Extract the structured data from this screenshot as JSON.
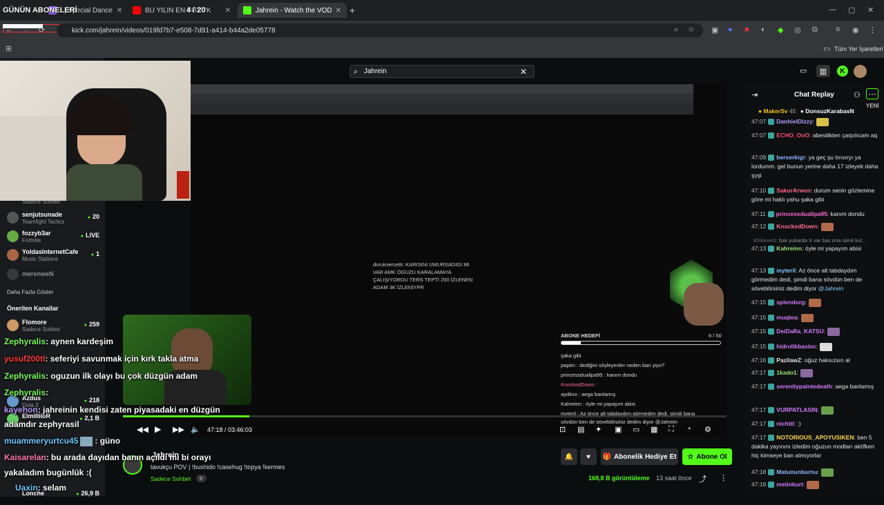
{
  "overlay_title": "GÜNÜN ABONELERİ",
  "tabs": [
    {
      "label": "l | Special Dance",
      "counter": "",
      "fav": "#8b5cf6"
    },
    {
      "label": "BU YILIN EN BÜYÜK SKANDALI",
      "counter": "4 / 20",
      "fav": "#ff0000"
    },
    {
      "label": "Jahrein - Watch the VOD on Kick",
      "counter": "",
      "fav": "#53fc18"
    }
  ],
  "new_tab": "+",
  "url": "kick.com/jahrein/videos/019fd7b7-e508-7d91-a414-b44a2de05778",
  "bookmarks_label": "Tüm Yer İşaretleri",
  "search_value": "Jahrein",
  "sidebar": {
    "channels": [
      {
        "name": "",
        "category": "Sadece Sohbet",
        "viewers": ""
      },
      {
        "name": "senjutsunade",
        "category": "Teamfight Tactics",
        "viewers": "20"
      },
      {
        "name": "fozzyb3ar",
        "category": "Fortnite",
        "viewers": "LIVE"
      },
      {
        "name": "YoldasInternetCafe",
        "category": "Music Stations",
        "viewers": "1"
      },
      {
        "name": "merenweN",
        "category": "",
        "viewers": ""
      }
    ],
    "show_more": "Daha Fazla Göster",
    "recommended_title": "Önerilen Kanallar",
    "recommended": [
      {
        "name": "Flomore",
        "category": "Sadece Sohbet",
        "viewers": "259"
      },
      {
        "name": "Azdus",
        "category": "Dota 2",
        "viewers": "218"
      },
      {
        "name": "ElmilliioR",
        "category": "",
        "viewers": "2,1 B"
      },
      {
        "name": "Lonche",
        "category": "",
        "viewers": "26,9 B"
      }
    ]
  },
  "overlay_chat": [
    {
      "user": "Zephyralis",
      "color": "#7cfc5a",
      "msg": ": aynen kardeşim"
    },
    {
      "user": "yusuf200tl",
      "color": "#ff3b3b",
      "msg": ": seferiyi savunmak için kırk takla atma"
    },
    {
      "user": "Zephyralis",
      "color": "#7cfc5a",
      "msg": ": oguzun ilk olayı bu çok düzgün adam"
    },
    {
      "user": "Zephyralis",
      "color": "#7cfc5a",
      "msg": ":"
    },
    {
      "user": "kayehon",
      "color": "#b59cff",
      "msg": ": jahreinin kendisi zaten piyasadaki en düzgün"
    },
    {
      "user": "",
      "color": "#fff",
      "msg": "adamdır zephyrasil"
    },
    {
      "user": "muammeryurtcu45",
      "color": "#6ec6ff",
      "msg": ": güno"
    },
    {
      "user": "Kaisarelan",
      "color": "#ff7ab0",
      "msg": ": bu arada dayıdan banın açıldı mı bi orayı"
    },
    {
      "user": "",
      "color": "#fff",
      "msg": "yakaladım bugünlük :("
    },
    {
      "user": "Uaxin",
      "color": "#6ec6ff",
      "msg": ": selam"
    }
  ],
  "game_stream_chat": {
    "highlight": "dorukvercetti: KARISINI UMURSADIGI MI VAR AMK OGUZU KARALAMAYA ÇALIŞIYORDU TERS TEPTİ 200 İZLENEN ADAM 3K İZLENİYPR",
    "sub_goal": "ABONE HEDEFİ",
    "sub_count": "6 / 50",
    "lines": [
      "şaka gibi",
      "papen : dediğini söyleyenler neden ban yiyo?",
      "princessdualipa95 : kanım dondu",
      "KnockedDown :",
      "aydiino : aega banlamış",
      "Kahreinn : öyle mi yapayım abisi",
      "myteril : Az önce alt tabdaydım görmedim dedi, şimdi bana",
      "sövdün ben de sövebilirsiniz dedim diyor @Jahrein"
    ]
  },
  "player": {
    "time": "47:18 / 03:46:03",
    "progress": 0.209
  },
  "video": {
    "channel": "Jahrein",
    "title": "tavukçu POV | !bushido !casehug !topya !kermes",
    "category": "Sadece Sohbet",
    "lang": "tr",
    "views": "168,8 B görüntüleme",
    "ago": "13 saat önce",
    "gift_label": "Abonelik Hediye Et",
    "sub_label": "Abone Ol"
  },
  "chat": {
    "title": "Chat Replay",
    "new_badge": "YENİ",
    "pinned": [
      {
        "user": "MakerSv",
        "count": "45"
      },
      {
        "user": "DonsuzKarabasN",
        "count": ""
      }
    ],
    "messages": [
      {
        "t": "47:07",
        "u": "DanhielDizzy",
        "c": "#b59cff",
        "m": ":",
        "e": "#d6c24a"
      },
      {
        "t": "47:07",
        "u": "ECHO_OoO",
        "c": "#ff4d6d",
        "m": ": abesilikten çarpılıcam aq",
        "e": ""
      },
      {
        "t": "47:09",
        "u": "berserkigr",
        "c": "#8fb8ff",
        "m": ": ya geç şu tırıvıryı ya lordumm. gel bunun yerine daha 17 izleyek daha şyşi",
        "e": ""
      },
      {
        "t": "47:10",
        "u": "SakurArwen",
        "c": "#ff6b8a",
        "m": ": durum senin gözlemine göre mi haklı yahu şaka gibi",
        "e": ""
      },
      {
        "t": "47:11",
        "u": "princessdualipa95",
        "c": "#ff6bd0",
        "m": ": kanım dondu",
        "e": ""
      },
      {
        "t": "47:12",
        "u": "KnockedDown",
        "c": "#ff6b8a",
        "m": ":",
        "e": "#b06a4a"
      },
      {
        "t": "",
        "u": "KhloreeX",
        "c": "#888",
        "m": ": bak yukarda X var bas ona isimli kul...",
        "e": ""
      },
      {
        "t": "47:13",
        "u": "Kahreinn",
        "c": "#9be47a",
        "m": ": öyle mi yapayım abisi",
        "e": ""
      },
      {
        "t": "47:13",
        "u": "myteril",
        "c": "#7ec8ff",
        "m": ": Az önce alt tabdaydım görmedim dedi, şimdi bana sövdün ben de sövebilirsiniz dedim diyor",
        "mention": "@Jahrein",
        "e": ""
      },
      {
        "t": "47:15",
        "u": "splendorg",
        "c": "#d47cff",
        "m": ":",
        "e": "#b06a4a"
      },
      {
        "t": "47:15",
        "u": "muqtea",
        "c": "#d47cff",
        "m": ":",
        "e": "#b06a4a"
      },
      {
        "t": "47:15",
        "u": "DeiDaRa_KATSU",
        "c": "#d47cff",
        "m": ":",
        "e": "#8a6aa0"
      },
      {
        "t": "47:15",
        "u": "hidrolikbasinc",
        "c": "#d47cff",
        "m": ":",
        "e": "#ddd"
      },
      {
        "t": "47:16",
        "u": "PazilawZ",
        "c": "#e6e6e6",
        "m": ": oğuz haksızsın al",
        "e": ""
      },
      {
        "t": "47:17",
        "u": "1kado1",
        "c": "#9be47a",
        "m": ":",
        "e": "#8a6aa0"
      },
      {
        "t": "47:17",
        "u": "serenitypaintedeath",
        "c": "#d47cff",
        "m": ": aega banlamış",
        "e": ""
      },
      {
        "t": "47:17",
        "u": "VURPATLASIN",
        "c": "#d47cff",
        "m": ":",
        "e": "#6aa04a"
      },
      {
        "t": "47:17",
        "u": "nichttl",
        "c": "#d47cff",
        "m": ": :)",
        "e": ""
      },
      {
        "t": "47:17",
        "u": "NOTORIOUS_APOYUSIKEN",
        "c": "#ffd84a",
        "m": ": ben 5 dakika yayınını izledim oğuzun modları aktifken hiç kimseye ban atmıyorlar",
        "e": ""
      },
      {
        "t": "47:18",
        "u": "Matununburnu",
        "c": "#8fb8ff",
        "m": ":",
        "e": "#6aa04a"
      },
      {
        "t": "47:18",
        "u": "metinkurt",
        "c": "#d47cff",
        "m": ":",
        "e": "#b06a4a"
      }
    ]
  }
}
